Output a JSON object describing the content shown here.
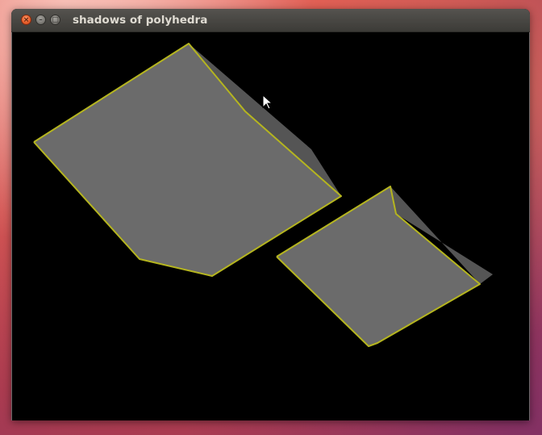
{
  "window": {
    "title": "shadows of polyhedra",
    "buttons": {
      "close": "×",
      "minimize": "–",
      "maximize": "□"
    }
  },
  "scene": {
    "background": "#000000",
    "face_color": "#6b6b6b",
    "side_color": "#555555",
    "edge_color": "#b5b51f"
  }
}
